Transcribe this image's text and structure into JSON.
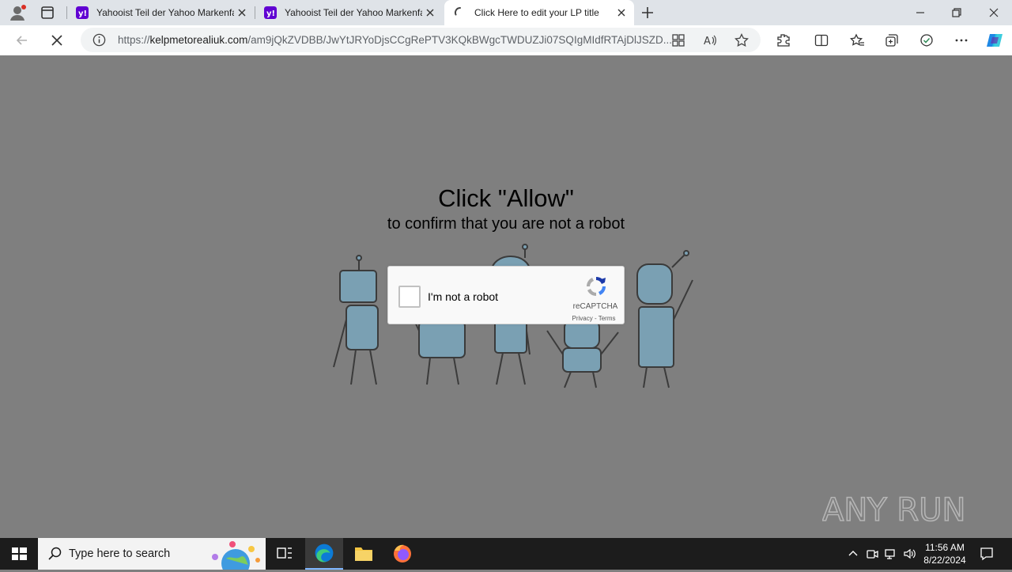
{
  "browser": {
    "tabs": [
      {
        "title": "Yahooist Teil der Yahoo Markenfamilie",
        "favicon": "yahoo-icon",
        "active": false
      },
      {
        "title": "Yahooist Teil der Yahoo Markenfamilie",
        "favicon": "yahoo-icon",
        "active": false
      },
      {
        "title": "Click Here to edit your LP title",
        "favicon": "loading-spinner-icon",
        "active": true
      }
    ],
    "address": {
      "scheme": "https://",
      "host": "kelpmetorealiuk.com",
      "path": "/am9jQkZVDBB/JwYtJRYoDjsCCgRePTV3KQkBWgcTWDUZJi07SQIgMIdfRTAjDlJSZD..."
    }
  },
  "page": {
    "headline": "Click \"Allow\"",
    "subline": "to confirm that you are not a robot",
    "captcha": {
      "label": "I'm not a robot",
      "brand": "reCAPTCHA",
      "privacy": "Privacy",
      "separator": " - ",
      "terms": "Terms"
    },
    "watermark": "ANY RUN"
  },
  "taskbar": {
    "search_placeholder": "Type here to search",
    "time": "11:56 AM",
    "date": "8/22/2024"
  },
  "colors": {
    "overlay": "#7f7f7f",
    "yahoo": "#6001d2",
    "robot_body": "#8fb6c9",
    "taskbar": "#1c1c1c"
  }
}
